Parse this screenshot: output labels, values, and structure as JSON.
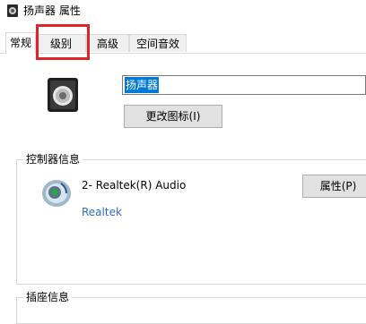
{
  "window": {
    "title": "扬声器 属性"
  },
  "tabs": [
    {
      "label": "常规",
      "active": true
    },
    {
      "label": "级别",
      "active": false,
      "highlighted": true
    },
    {
      "label": "高级",
      "active": false
    },
    {
      "label": "空间音效",
      "active": false
    }
  ],
  "general": {
    "device_name_value": "扬声器",
    "change_icon_label": "更改图标(I)",
    "controller_group_label": "控制器信息",
    "controller_name": "2- Realtek(R) Audio",
    "controller_vendor": "Realtek",
    "properties_label": "属性(P)",
    "plugin_group_label": "插座信息"
  },
  "colors": {
    "highlight_border": "#d8262c",
    "selection": "#0078d7",
    "link": "#2e6fb5"
  },
  "icons": {
    "title": "speaker-icon",
    "device": "speaker-icon",
    "controller": "audio-controller-icon"
  }
}
